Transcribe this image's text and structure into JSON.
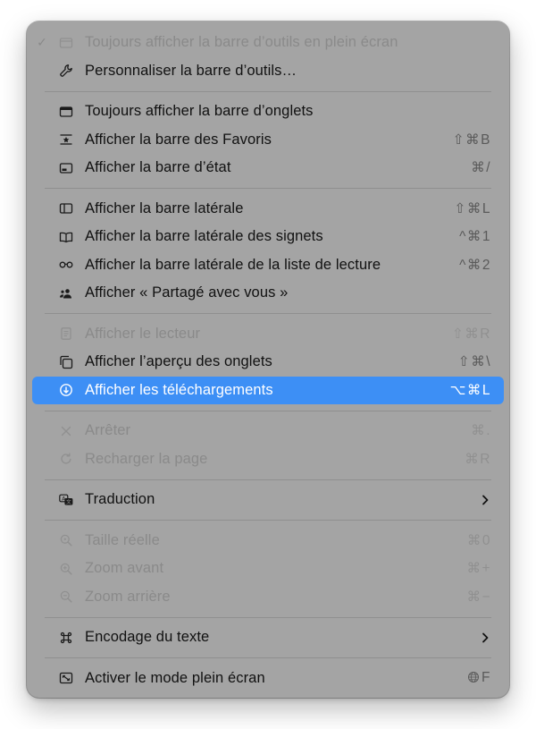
{
  "menu": {
    "items": {
      "fullscreen_toolbar": {
        "label": "Toujours afficher la barre d’outils en plein écran",
        "check": "✓"
      },
      "customize_toolbar": {
        "label": "Personnaliser la barre d’outils…"
      },
      "always_tab_bar": {
        "label": "Toujours afficher la barre d’onglets"
      },
      "favorites_bar": {
        "label": "Afficher la barre des Favoris",
        "shortcut": "⇧⌘B"
      },
      "status_bar": {
        "label": "Afficher la barre d’état",
        "shortcut": "⌘/"
      },
      "sidebar": {
        "label": "Afficher la barre latérale",
        "shortcut": "⇧⌘L"
      },
      "bookmarks_sidebar": {
        "label": "Afficher la barre latérale des signets",
        "shortcut": "^⌘1"
      },
      "reading_list_sidebar": {
        "label": "Afficher la barre latérale de la liste de lecture",
        "shortcut": "^⌘2"
      },
      "shared_with_you": {
        "label": "Afficher « Partagé avec vous »"
      },
      "reader": {
        "label": "Afficher le lecteur",
        "shortcut": "⇧⌘R"
      },
      "tab_overview": {
        "label": "Afficher l’aperçu des onglets",
        "shortcut": "⇧⌘\\"
      },
      "downloads": {
        "label": "Afficher les téléchargements",
        "shortcut": "⌥⌘L"
      },
      "stop": {
        "label": "Arrêter",
        "shortcut": "⌘."
      },
      "reload": {
        "label": "Recharger la page",
        "shortcut": "⌘R"
      },
      "translation": {
        "label": "Traduction"
      },
      "actual_size": {
        "label": "Taille réelle",
        "shortcut": "⌘0"
      },
      "zoom_in": {
        "label": "Zoom avant",
        "shortcut": "⌘+"
      },
      "zoom_out": {
        "label": "Zoom arrière",
        "shortcut": "⌘−"
      },
      "text_encoding": {
        "label": "Encodage du texte"
      },
      "fullscreen_mode": {
        "label": "Activer le mode plein écran",
        "shortcut": "F"
      }
    }
  },
  "colors": {
    "menu_background": "#a4a4a4",
    "highlight": "#3d8ff5",
    "disabled_text": "#8a8a8a"
  }
}
